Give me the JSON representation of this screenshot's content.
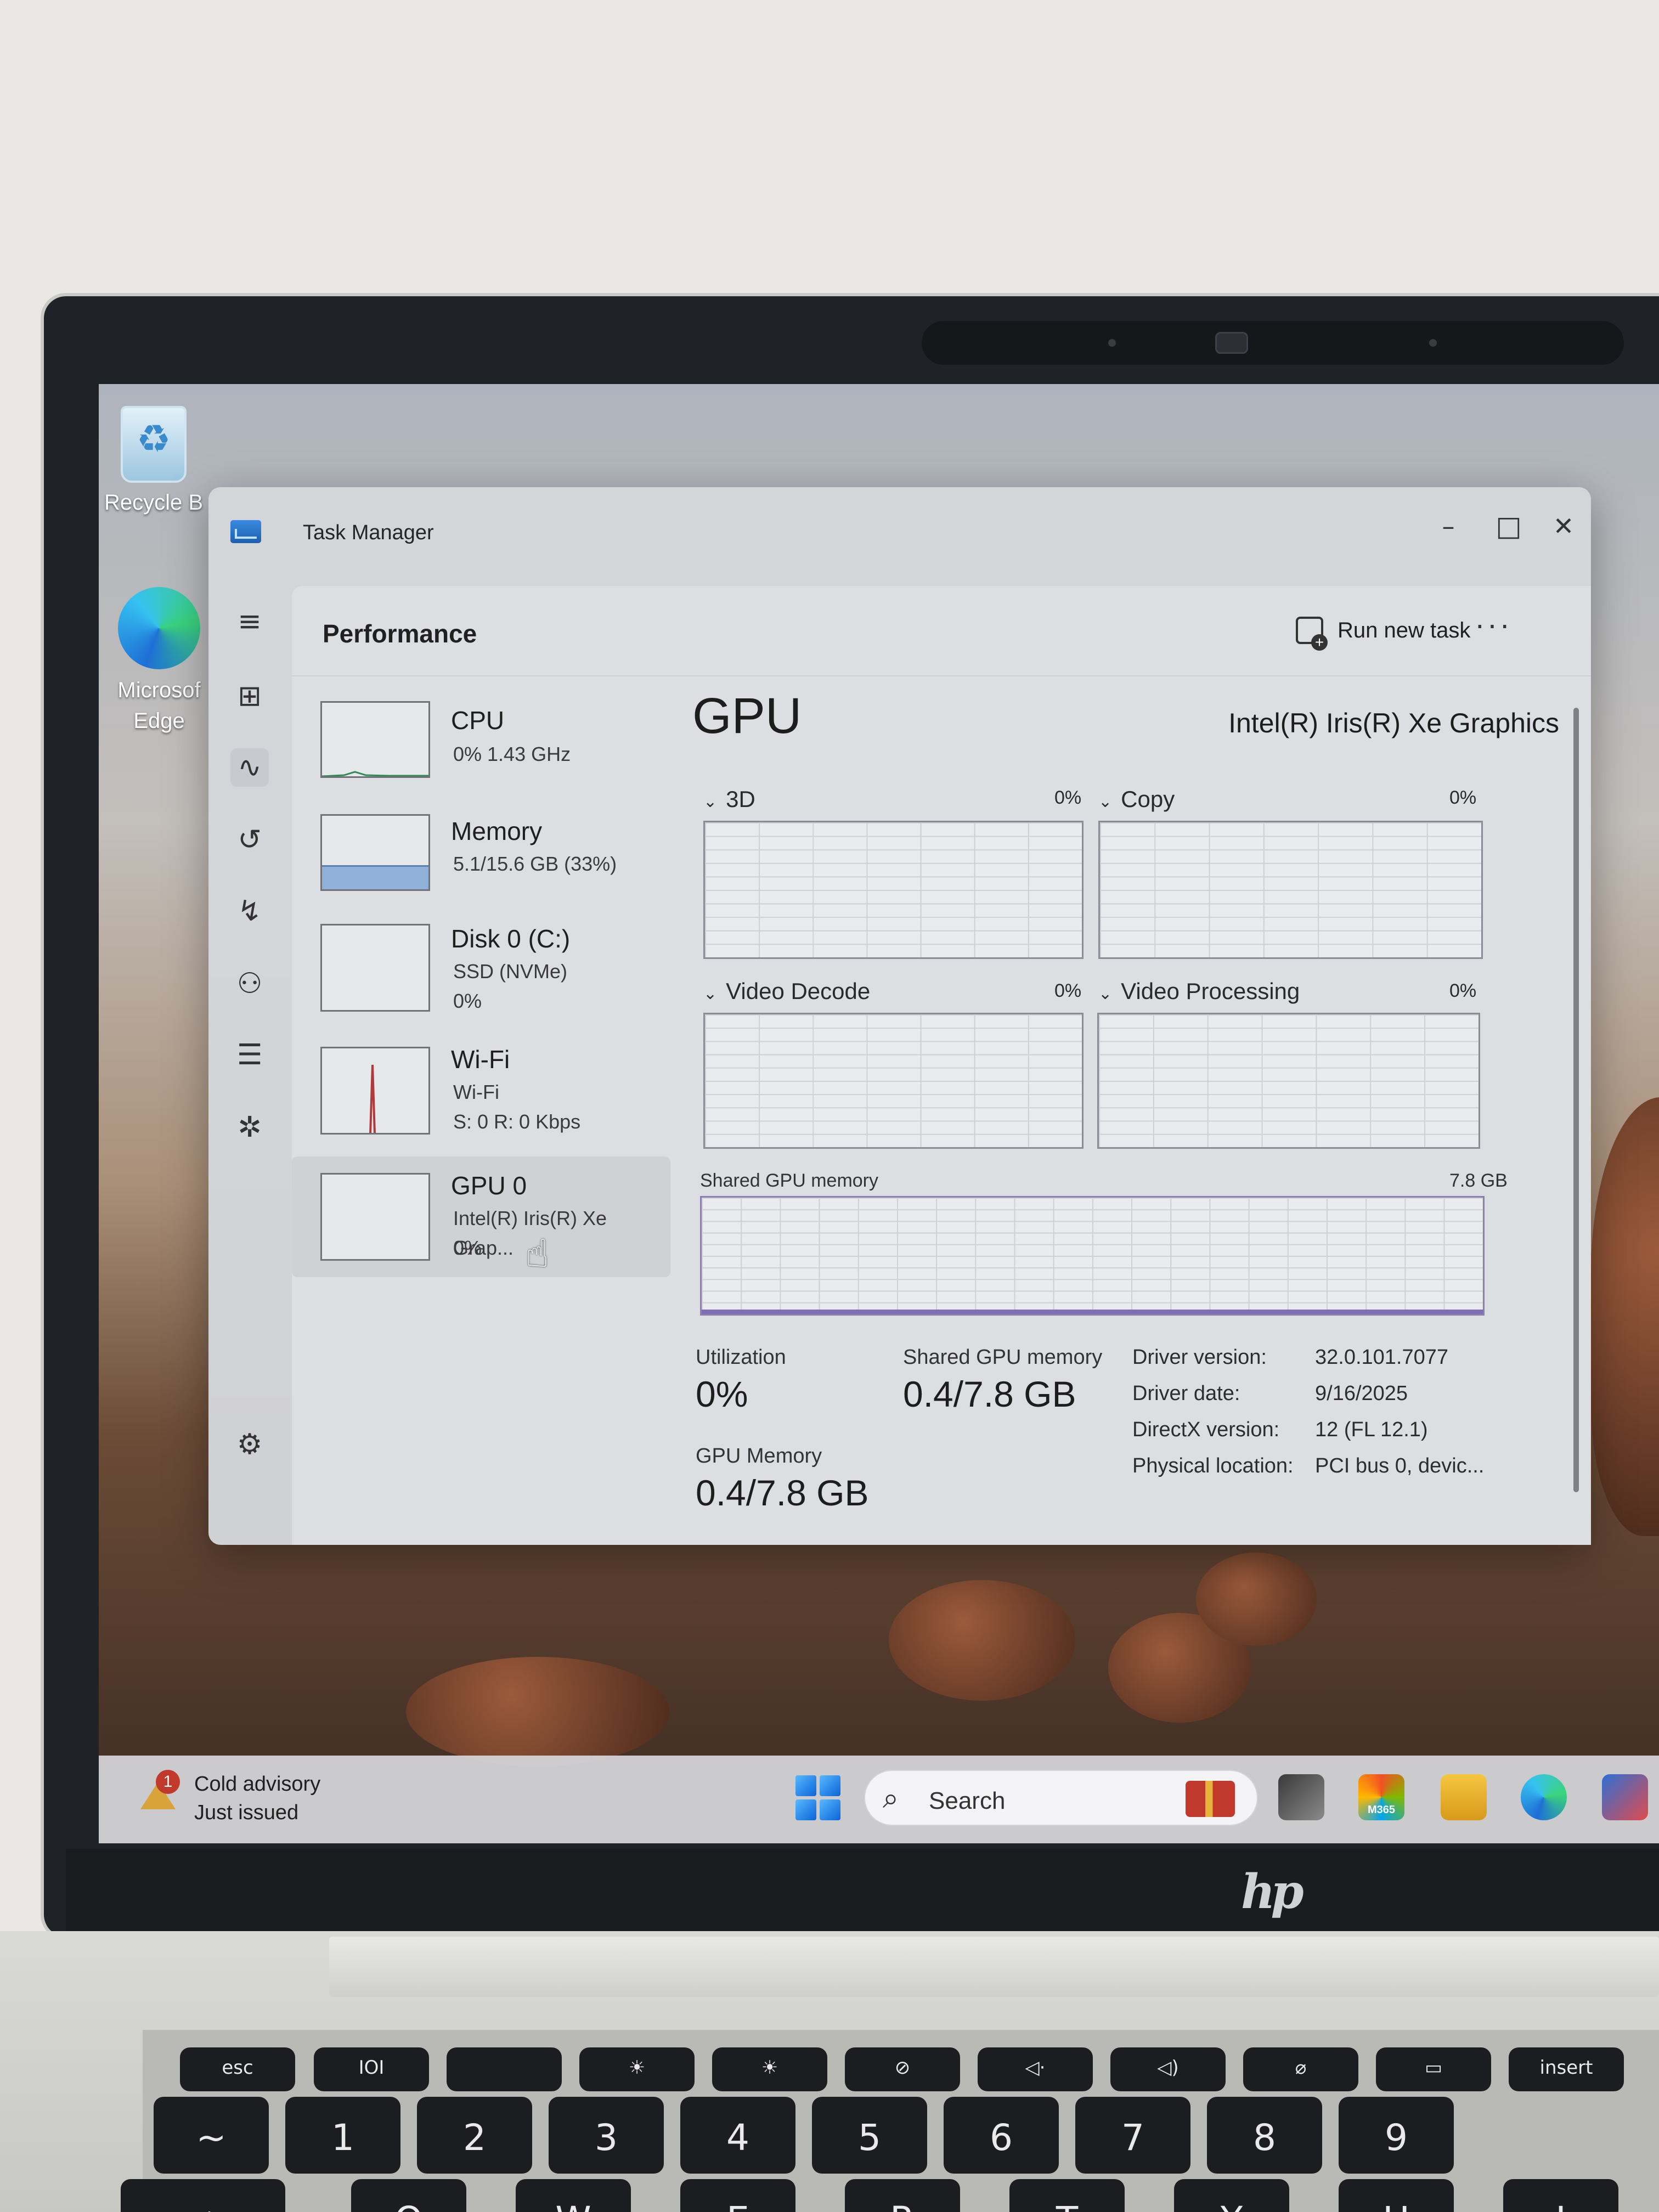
{
  "desktop": {
    "icons": [
      {
        "label": "Recycle B"
      },
      {
        "label": "Microsof Edge"
      }
    ]
  },
  "window": {
    "title": "Task Manager",
    "controls": {
      "minimize": "–",
      "maximize": "□",
      "close": "✕"
    }
  },
  "nav": {
    "items": [
      "menu-icon",
      "processes-icon",
      "performance-icon",
      "app-history-icon",
      "startup-apps-icon",
      "users-icon",
      "details-icon",
      "services-icon",
      "settings-icon"
    ],
    "selected": "performance-icon"
  },
  "header": {
    "title": "Performance",
    "run_new_task": "Run new task",
    "more": "···"
  },
  "devices": [
    {
      "name": "CPU",
      "sub1": "0%  1.43 GHz",
      "sub2": "",
      "sub3": ""
    },
    {
      "name": "Memory",
      "sub1": "5.1/15.6 GB (33%)",
      "sub2": "",
      "sub3": ""
    },
    {
      "name": "Disk 0 (C:)",
      "sub1": "SSD (NVMe)",
      "sub2": "0%",
      "sub3": ""
    },
    {
      "name": "Wi-Fi",
      "sub1": "Wi-Fi",
      "sub2": "S: 0  R: 0 Kbps",
      "sub3": ""
    },
    {
      "name": "GPU 0",
      "sub1": "Intel(R) Iris(R) Xe Grap...",
      "sub2": "0%",
      "sub3": ""
    }
  ],
  "memory_used_fraction": 0.33,
  "gpu": {
    "title": "GPU",
    "model": "Intel(R) Iris(R) Xe Graphics",
    "engines": [
      {
        "name": "3D",
        "pct": "0%"
      },
      {
        "name": "Copy",
        "pct": "0%"
      },
      {
        "name": "Video Decode",
        "pct": "0%"
      },
      {
        "name": "Video Processing",
        "pct": "0%"
      }
    ],
    "shared_memory_label": "Shared GPU memory",
    "shared_memory_max": "7.8 GB",
    "stats": {
      "utilization_label": "Utilization",
      "utilization_value": "0%",
      "shared_label": "Shared GPU memory",
      "shared_value": "0.4/7.8 GB",
      "gpu_memory_label": "GPU Memory",
      "gpu_memory_value": "0.4/7.8 GB"
    },
    "details": [
      {
        "key": "Driver version:",
        "value": "32.0.101.7077"
      },
      {
        "key": "Driver date:",
        "value": "9/16/2025"
      },
      {
        "key": "DirectX version:",
        "value": "12 (FL 12.1)"
      },
      {
        "key": "Physical location:",
        "value": "PCI bus 0, devic..."
      }
    ]
  },
  "taskbar": {
    "weather_badge": "1",
    "weather_title": "Cold advisory",
    "weather_sub": "Just issued",
    "search_label": "Search",
    "m365_label": "M365"
  },
  "laptop": {
    "brand": "hp",
    "fn_keys": [
      "esc",
      "IOI",
      "",
      "☀",
      "☀",
      "⊘",
      "◁·",
      "◁)",
      "⌀",
      "▭",
      "insert"
    ],
    "num_keys": [
      "~",
      "1",
      "2",
      "3",
      "4",
      "5",
      "6",
      "7",
      "8",
      "9"
    ],
    "alpha_keys": [
      "tab",
      "Q",
      "W",
      "E",
      "R",
      "T",
      "Y",
      "U",
      "I"
    ]
  }
}
